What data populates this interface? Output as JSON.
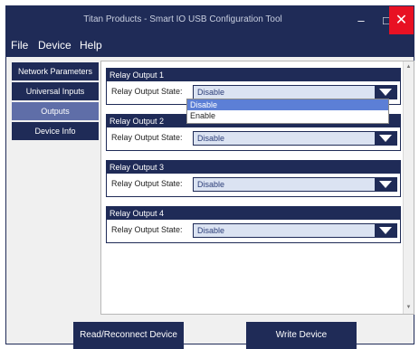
{
  "window": {
    "title": "Titan Products - Smart IO USB Configuration Tool",
    "minimize_icon": "minimize-icon",
    "maximize_icon": "maximize-icon",
    "close_icon": "close-icon",
    "colors": {
      "frame": "#1f2b57",
      "accent": "#5f6ea8",
      "close": "#e81123",
      "field": "#dbe3f2"
    }
  },
  "menu": {
    "file": "File",
    "device": "Device",
    "help": "Help"
  },
  "sidebar": {
    "items": [
      {
        "label": "Network Parameters"
      },
      {
        "label": "Universal Inputs"
      },
      {
        "label": "Outputs",
        "active": true
      },
      {
        "label": "Device Info"
      }
    ]
  },
  "outputs": {
    "groups": [
      {
        "title": "Relay Output 1",
        "label": "Relay Output State:",
        "value": "Disable"
      },
      {
        "title": "Relay Output 2",
        "label": "Relay Output State:",
        "value": "Disable"
      },
      {
        "title": "Relay Output 3",
        "label": "Relay Output State:",
        "value": "Disable"
      },
      {
        "title": "Relay Output 4",
        "label": "Relay Output State:",
        "value": "Disable"
      }
    ],
    "dropdown_options": [
      "Disable",
      "Enable"
    ],
    "dropdown_selected": "Disable"
  },
  "buttons": {
    "read": "Read/Reconnect Device",
    "write": "Write Device"
  }
}
